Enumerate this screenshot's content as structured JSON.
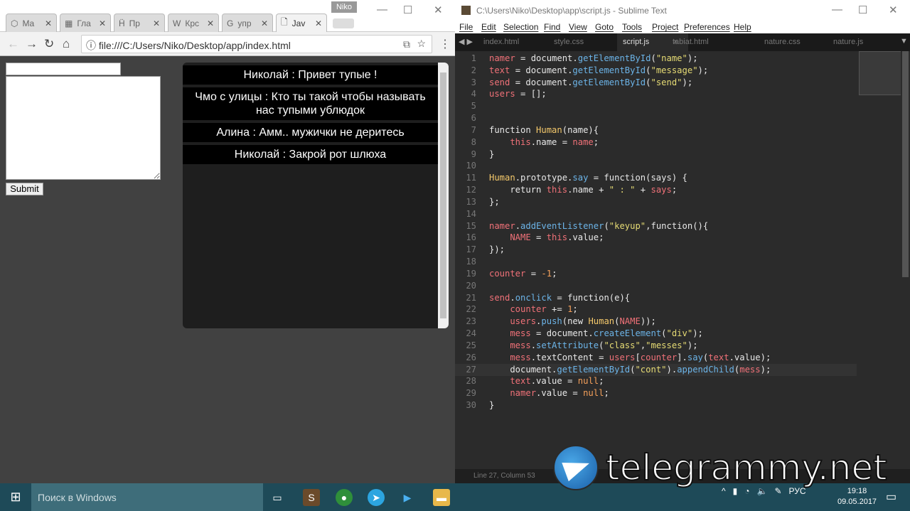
{
  "browser": {
    "profile": "Niko",
    "tabs": [
      {
        "icon": "⬡",
        "label": "Ma"
      },
      {
        "icon": "▦",
        "label": "Гла"
      },
      {
        "icon": "Ḧ",
        "label": "Пр"
      },
      {
        "icon": "W",
        "label": "Крс"
      },
      {
        "icon": "G",
        "label": "упр"
      },
      {
        "icon": "🗋",
        "label": "Jav"
      }
    ],
    "url": "file:///C:/Users/Niko/Desktop/app/index.html",
    "submit_label": "Submit",
    "name_value": "",
    "message_value": "",
    "messages": [
      "Николай : Привет тупые !",
      "Чмо с улицы : Кто ты такой чтобы называть нас тупыми ублюдок",
      "Алина : Амм.. мужички не деритесь",
      "Николай : Закрой рот шлюха"
    ]
  },
  "editor": {
    "title": "C:\\Users\\Niko\\Desktop\\app\\script.js - Sublime Text",
    "menu": [
      "File",
      "Edit",
      "Selection",
      "Find",
      "View",
      "Goto",
      "Tools",
      "Project",
      "Preferences",
      "Help"
    ],
    "tabs": [
      "index.html",
      "style.css",
      "script.js",
      "tabiat.html",
      "nature.css",
      "nature.js"
    ],
    "active_tab": "script.js",
    "status": "Line 27, Column 53",
    "current_line": 27,
    "lines": [
      [
        [
          "namer",
          "v"
        ],
        [
          " = document.",
          "d"
        ],
        [
          "getElementById",
          "f"
        ],
        [
          "(",
          "d"
        ],
        [
          "\"name\"",
          "s"
        ],
        [
          ");",
          "d"
        ]
      ],
      [
        [
          "text",
          "v"
        ],
        [
          " = document.",
          "d"
        ],
        [
          "getElementById",
          "f"
        ],
        [
          "(",
          "d"
        ],
        [
          "\"message\"",
          "s"
        ],
        [
          ");",
          "d"
        ]
      ],
      [
        [
          "send",
          "v"
        ],
        [
          " = document.",
          "d"
        ],
        [
          "getElementById",
          "f"
        ],
        [
          "(",
          "d"
        ],
        [
          "\"send\"",
          "s"
        ],
        [
          ");",
          "d"
        ]
      ],
      [
        [
          "users",
          "v"
        ],
        [
          " = [];",
          "d"
        ]
      ],
      [],
      [],
      [
        [
          "function ",
          "k"
        ],
        [
          "Human",
          "c"
        ],
        [
          "(name){",
          "d"
        ]
      ],
      [
        [
          "    this",
          "t"
        ],
        [
          ".name = ",
          "d"
        ],
        [
          "name",
          "v"
        ],
        [
          ";",
          "d"
        ]
      ],
      [
        [
          "}",
          "d"
        ]
      ],
      [],
      [
        [
          "Human",
          "c"
        ],
        [
          ".prototype.",
          "d"
        ],
        [
          "say",
          "f"
        ],
        [
          " = function(says) {",
          "d"
        ]
      ],
      [
        [
          "    return ",
          "k"
        ],
        [
          "this",
          "t"
        ],
        [
          ".name + ",
          "d"
        ],
        [
          "\" : \"",
          "s"
        ],
        [
          " + ",
          "d"
        ],
        [
          "says",
          "v"
        ],
        [
          ";",
          "d"
        ]
      ],
      [
        [
          "};",
          "d"
        ]
      ],
      [],
      [
        [
          "namer",
          "v"
        ],
        [
          ".",
          "d"
        ],
        [
          "addEventListener",
          "f"
        ],
        [
          "(",
          "d"
        ],
        [
          "\"keyup\"",
          "s"
        ],
        [
          ",function(){",
          "d"
        ]
      ],
      [
        [
          "    NAME",
          "v"
        ],
        [
          " = ",
          "d"
        ],
        [
          "this",
          "t"
        ],
        [
          ".value;",
          "d"
        ]
      ],
      [
        [
          "});",
          "d"
        ]
      ],
      [],
      [
        [
          "counter",
          "v"
        ],
        [
          " = ",
          "d"
        ],
        [
          "-1",
          "n"
        ],
        [
          ";",
          "d"
        ]
      ],
      [],
      [
        [
          "send",
          "v"
        ],
        [
          ".",
          "d"
        ],
        [
          "onclick",
          "f"
        ],
        [
          " = function(e){",
          "d"
        ]
      ],
      [
        [
          "    counter",
          "v"
        ],
        [
          " += ",
          "d"
        ],
        [
          "1",
          "n"
        ],
        [
          ";",
          "d"
        ]
      ],
      [
        [
          "    users",
          "v"
        ],
        [
          ".",
          "d"
        ],
        [
          "push",
          "f"
        ],
        [
          "(new ",
          "d"
        ],
        [
          "Human",
          "c"
        ],
        [
          "(",
          "d"
        ],
        [
          "NAME",
          "v"
        ],
        [
          "));",
          "d"
        ]
      ],
      [
        [
          "    mess",
          "v"
        ],
        [
          " = document.",
          "d"
        ],
        [
          "createElement",
          "f"
        ],
        [
          "(",
          "d"
        ],
        [
          "\"div\"",
          "s"
        ],
        [
          ");",
          "d"
        ]
      ],
      [
        [
          "    mess",
          "v"
        ],
        [
          ".",
          "d"
        ],
        [
          "setAttribute",
          "f"
        ],
        [
          "(",
          "d"
        ],
        [
          "\"class\"",
          "s"
        ],
        [
          ",",
          "d"
        ],
        [
          "\"messes\"",
          "s"
        ],
        [
          ");",
          "d"
        ]
      ],
      [
        [
          "    mess",
          "v"
        ],
        [
          ".textContent = ",
          "d"
        ],
        [
          "users",
          "v"
        ],
        [
          "[",
          "d"
        ],
        [
          "counter",
          "v"
        ],
        [
          "].",
          "d"
        ],
        [
          "say",
          "f"
        ],
        [
          "(",
          "d"
        ],
        [
          "text",
          "v"
        ],
        [
          ".value);",
          "d"
        ]
      ],
      [
        [
          "    document.",
          "d"
        ],
        [
          "getElementById",
          "f"
        ],
        [
          "(",
          "d"
        ],
        [
          "\"cont\"",
          "s"
        ],
        [
          ").",
          "d"
        ],
        [
          "appendChild",
          "f"
        ],
        [
          "(",
          "d"
        ],
        [
          "mess",
          "v"
        ],
        [
          ");",
          "d"
        ]
      ],
      [
        [
          "    text",
          "v"
        ],
        [
          ".value = ",
          "d"
        ],
        [
          "null",
          "n"
        ],
        [
          ";",
          "d"
        ]
      ],
      [
        [
          "    namer",
          "v"
        ],
        [
          ".value = ",
          "d"
        ],
        [
          "null",
          "n"
        ],
        [
          ";",
          "d"
        ]
      ],
      [
        [
          "}",
          "d"
        ]
      ]
    ]
  },
  "watermark": "telegrammy.net",
  "taskbar": {
    "search_placeholder": "Поиск в Windows",
    "lang": "РУС",
    "time": "19:18",
    "date": "09.05.2017"
  }
}
